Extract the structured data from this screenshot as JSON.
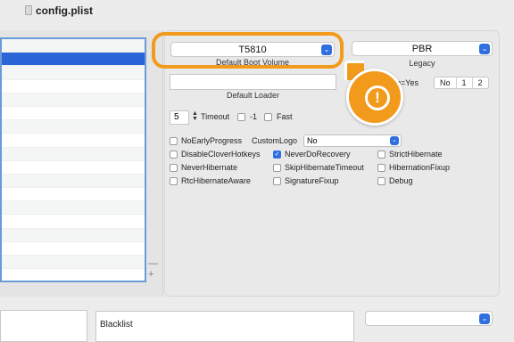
{
  "window": {
    "title": "config.plist"
  },
  "left_list": {
    "row_count": 18,
    "selected_index": 1
  },
  "boot": {
    "default_boot_volume_value": "T5810",
    "default_boot_volume_caption": "Default Boot Volume",
    "legacy_value": "PBR",
    "legacy_caption": "Legacy",
    "default_loader_value": "",
    "default_loader_caption": "Default Loader",
    "xmp_label": "ction=Yes",
    "xmp_options": [
      "No",
      "1",
      "2"
    ],
    "timeout_value": "5",
    "timeout_label": "Timeout",
    "minus1_label": "-1",
    "fast_label": "Fast"
  },
  "options": [
    {
      "label": "NoEarlyProgress",
      "checked": false
    },
    {
      "label": "DisableCloverHotkeys",
      "checked": false
    },
    {
      "label": "NeverDoRecovery",
      "checked": true
    },
    {
      "label": "StrictHibernate",
      "checked": false
    },
    {
      "label": "NeverHibernate",
      "checked": false
    },
    {
      "label": "SkipHibernateTimeout",
      "checked": false
    },
    {
      "label": "HibernationFixup",
      "checked": false
    },
    {
      "label": "RtcHibernateAware",
      "checked": false
    },
    {
      "label": "SignatureFixup",
      "checked": false
    },
    {
      "label": "Debug",
      "checked": false
    }
  ],
  "custom_logo": {
    "label": "CustomLogo",
    "value": "No"
  },
  "bottom": {
    "blacklist_label": "Blacklist",
    "list_controls": {
      "minus": "—",
      "plus": "+"
    }
  },
  "colors": {
    "accent": "#2f6fe0",
    "callout": "#f29a1b",
    "selection": "#2a66d8"
  },
  "icons": {
    "warning": "exclamation-icon",
    "chevron": "chevron-updown-icon"
  }
}
